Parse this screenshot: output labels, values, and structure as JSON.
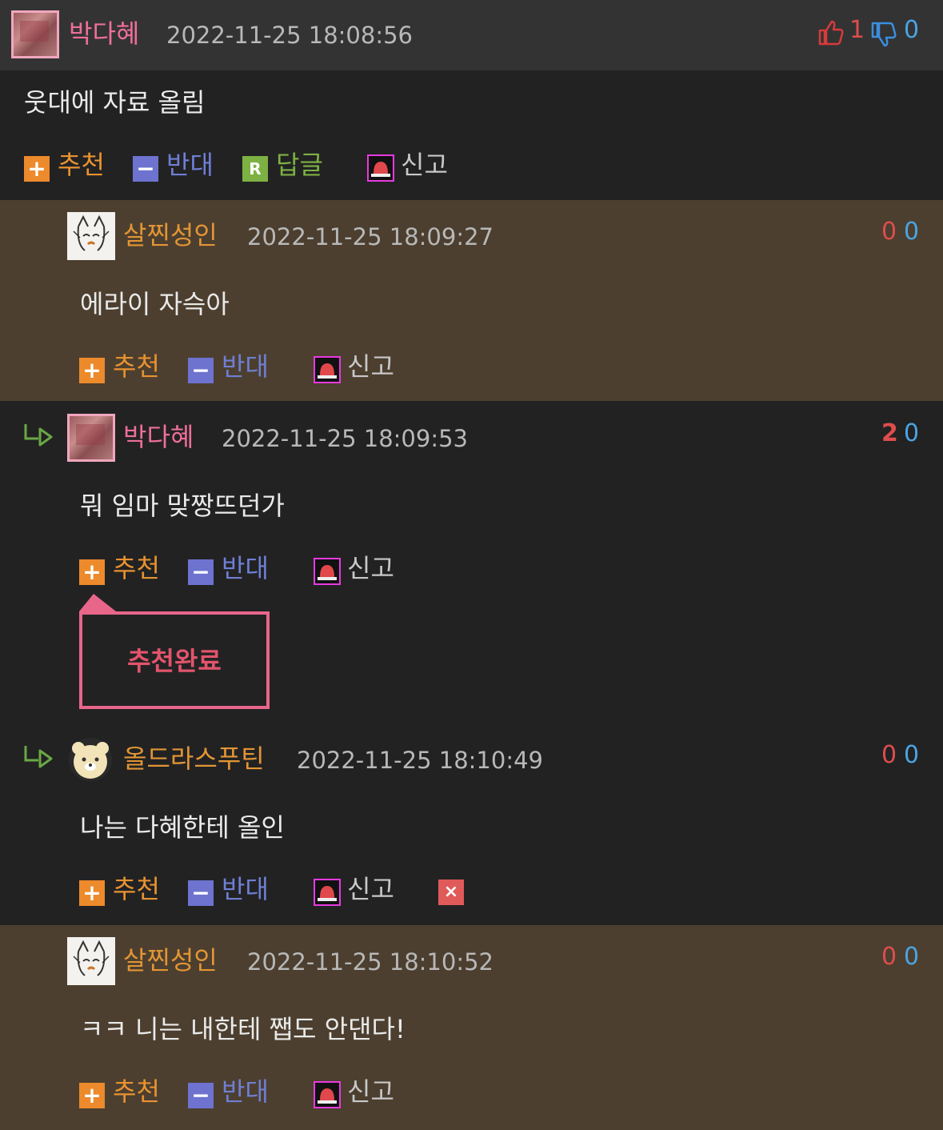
{
  "colors": {
    "page_bg": "#222223",
    "header_bg": "#333334",
    "highlight_bg": "#4c3f2f",
    "accent_pink": "#ee6f98",
    "accent_orange": "#e39535",
    "up_red": "#de4d4d",
    "down_blue": "#4aa4e2"
  },
  "actions": {
    "recommend": "추천",
    "oppose": "반대",
    "reply": "답글",
    "report": "신고",
    "reply_icon_letter": "R",
    "delete_icon": "×",
    "plus": "+",
    "minus": "−"
  },
  "comments": [
    {
      "name": "박다혜",
      "time": "2022-11-25 18:08:56",
      "text": "웃대에 자료 올림",
      "up": "1",
      "down": "0",
      "avatar": "photo-avatar",
      "up_icon": "thumbs-up-icon",
      "down_icon": "thumbs-down-icon"
    },
    {
      "name": "살찐성인",
      "time": "2022-11-25 18:09:27",
      "text": "에라이 자슥아",
      "up": "0",
      "down": "0",
      "avatar": "cat-drawing-avatar"
    },
    {
      "name": "박다혜",
      "time": "2022-11-25 18:09:53",
      "text": "뭐 임마 맞짱뜨던가",
      "up": "2",
      "down": "0",
      "avatar": "photo-avatar",
      "reply_icon": "reply-arrow-icon"
    },
    {
      "name": "올드라스푸틴",
      "time": "2022-11-25 18:10:49",
      "text": "나는 다혜한테 올인",
      "up": "0",
      "down": "0",
      "avatar": "bear-avatar",
      "reply_icon": "reply-arrow-icon"
    },
    {
      "name": "살찐성인",
      "time": "2022-11-25 18:10:52",
      "text": "ㅋㅋ 니는 내한테 쨉도 안댄다!",
      "up": "0",
      "down": "0",
      "avatar": "cat-drawing-avatar"
    }
  ],
  "tooltip": {
    "text": "추천완료"
  }
}
